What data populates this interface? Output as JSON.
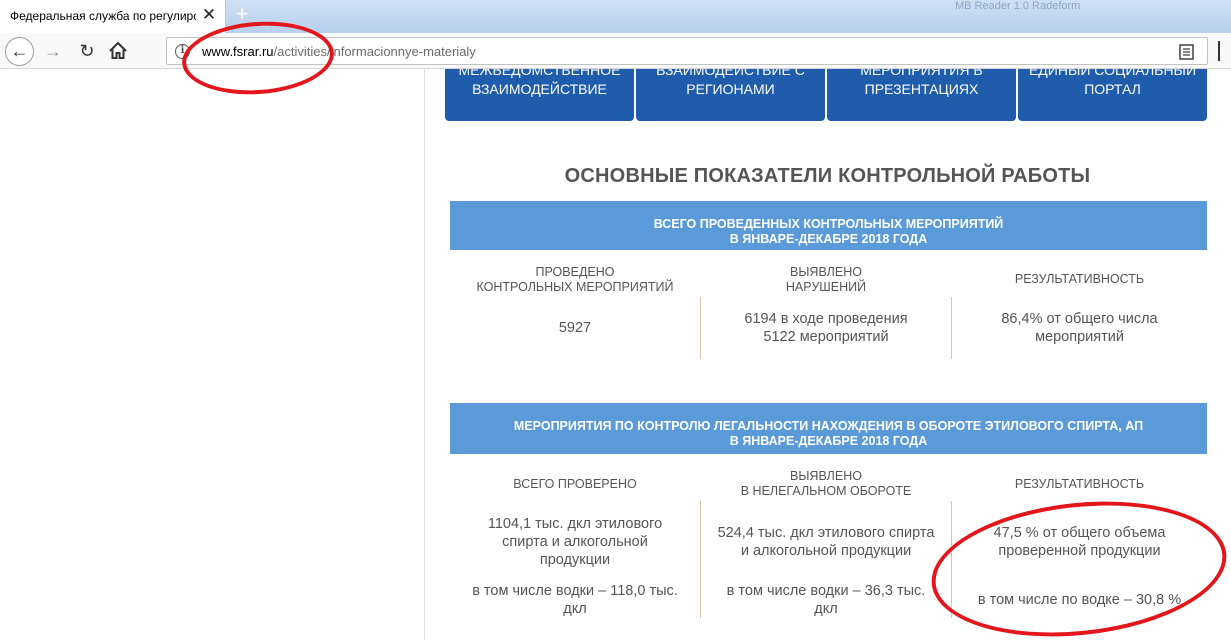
{
  "browser": {
    "tab_title": "Федеральная служба по регулиро",
    "tab_close": "✕",
    "new_tab": "+",
    "window_ghost_text": "МВ Reader 1.0 Radeform",
    "back_glyph": "←",
    "forward_glyph": "→",
    "reload_glyph": "↻",
    "info_glyph": "i",
    "url_domain": "www.fsrar.ru",
    "url_path": "/activities/informacionnye-materialy"
  },
  "top_buttons": [
    {
      "line1": "межведомственное",
      "line2": "взаимодействие"
    },
    {
      "line1": "взаимодействие с",
      "line2": "регионами"
    },
    {
      "line1": "мероприятия в",
      "line2": "презентациях"
    },
    {
      "line1": "единый социальный",
      "line2": "портал"
    }
  ],
  "page_title": "ОСНОВНЫЕ ПОКАЗАТЕЛИ КОНТРОЛЬНОЙ РАБОТЫ",
  "section1": {
    "band_line1": "ВСЕГО ПРОВЕДЕННЫХ КОНТРОЛЬНЫХ МЕРОПРИЯТИЙ",
    "band_line2": "В ЯНВАРЕ-ДЕКАБРЕ 2018 ГОДА",
    "col1_header_line1": "Проведено",
    "col1_header_line2": "контрольных мероприятий",
    "col2_header_line1": "Выявлено",
    "col2_header_line2": "нарушений",
    "col3_header": "Результативность",
    "col1_value": "5927",
    "col2_value_line1": "6194 в ходе проведения",
    "col2_value_line2": "5122 мероприятий",
    "col3_value_line1": "86,4% от общего числа",
    "col3_value_line2": "мероприятий"
  },
  "section2": {
    "band_line1": "МЕРОПРИЯТИЯ ПО КОНТРОЛЮ ЛЕГАЛЬНОСТИ НАХОЖДЕНИЯ В ОБОРОТЕ ЭТИЛОВОГО СПИРТА, АП",
    "band_line2": "В  ЯНВАРЕ-ДЕКАБРЕ 2018 ГОДА",
    "col1_header": "Всего проверено",
    "col2_header_line1": "Выявлено",
    "col2_header_line2": "в нелегальном обороте",
    "col3_header": "Результативность",
    "col1_value_line1": "1104,1 тыс. дкл этилового",
    "col1_value_line2": "спирта и алкогольной",
    "col1_value_line3": "продукции",
    "col1_sub_line1": "в том числе водки – 118,0 тыс.",
    "col1_sub_line2": "дкл",
    "col2_value_line1": "524,4 тыс. дкл этилового спирта",
    "col2_value_line2": "и алкогольной продукции",
    "col2_sub_line1": "в том числе водки – 36,3 тыс.",
    "col2_sub_line2": "дкл",
    "col3_value_line1": "47,5 % от общего объема",
    "col3_value_line2": "проверенной продукции",
    "col3_sub": "в том числе по водке – 30,8 %"
  },
  "colors": {
    "button_blue": "#1f5cac",
    "band_blue": "#5b9ad8",
    "title_gray": "#555555",
    "annotation_red": "#e3161b"
  }
}
